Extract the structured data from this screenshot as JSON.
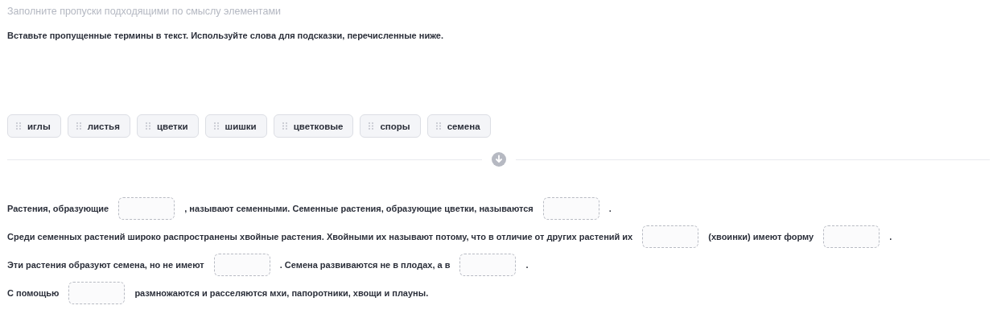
{
  "title": "Заполните пропуски подходящими по смыслу элементами",
  "instruction": "Вставьте пропущенные термины в текст. Используйте слова для подсказки, перечисленные ниже.",
  "word_bank": [
    "иглы",
    "листья",
    "цветки",
    "шишки",
    "цветковые",
    "споры",
    "семена"
  ],
  "sentences": [
    [
      {
        "kind": "text",
        "text": "Растения, образующие"
      },
      {
        "kind": "blank"
      },
      {
        "kind": "text",
        "text": ", называют семенными. Семенные растения, образующие цветки, называются"
      },
      {
        "kind": "blank"
      },
      {
        "kind": "text",
        "text": "."
      }
    ],
    [
      {
        "kind": "text",
        "text": "Среди семенных растений широко распространены хвойные растения. Хвойными их называют потому, что в отличие от других растений их"
      },
      {
        "kind": "blank"
      },
      {
        "kind": "text",
        "text": "(хвоинки) имеют форму"
      },
      {
        "kind": "blank"
      },
      {
        "kind": "text",
        "text": "."
      }
    ],
    [
      {
        "kind": "text",
        "text": "Эти растения образуют семена, но не имеют"
      },
      {
        "kind": "blank"
      },
      {
        "kind": "text",
        "text": ". Семена развиваются не в плодах, а в"
      },
      {
        "kind": "blank"
      },
      {
        "kind": "text",
        "text": "."
      }
    ],
    [
      {
        "kind": "text",
        "text": "С помощью"
      },
      {
        "kind": "blank"
      },
      {
        "kind": "text",
        "text": "размножаются и расселяются мхи, папоротники, хвощи и плауны."
      }
    ]
  ]
}
